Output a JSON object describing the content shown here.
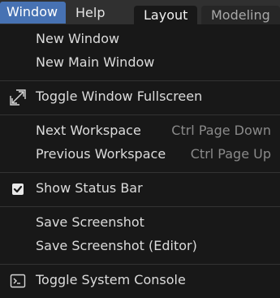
{
  "topbar": {
    "menus": [
      "Window",
      "Help"
    ],
    "workspace_tabs": [
      "Layout",
      "Modeling"
    ]
  },
  "menu": {
    "groups": [
      {
        "items": [
          {
            "label": "New Window",
            "shortcut": ""
          },
          {
            "label": "New Main Window",
            "shortcut": ""
          }
        ]
      },
      {
        "items": [
          {
            "label": "Toggle Window Fullscreen",
            "shortcut": "",
            "icon": "fullscreen-icon"
          }
        ]
      },
      {
        "items": [
          {
            "label": "Next Workspace",
            "shortcut": "Ctrl Page Down"
          },
          {
            "label": "Previous Workspace",
            "shortcut": "Ctrl Page Up"
          }
        ]
      },
      {
        "items": [
          {
            "label": "Show Status Bar",
            "shortcut": "",
            "icon": "checkbox-checked-icon",
            "checked": true
          }
        ]
      },
      {
        "items": [
          {
            "label": "Save Screenshot",
            "shortcut": ""
          },
          {
            "label": "Save Screenshot (Editor)",
            "shortcut": ""
          }
        ]
      },
      {
        "items": [
          {
            "label": "Toggle System Console",
            "shortcut": "",
            "icon": "console-icon"
          }
        ]
      }
    ]
  },
  "colors": {
    "menu_bg": "#181818",
    "active_menu_bg": "#4772b3",
    "topbar_bg": "#303030",
    "separator": "#333333",
    "checkbox": "#e8e8e8"
  }
}
